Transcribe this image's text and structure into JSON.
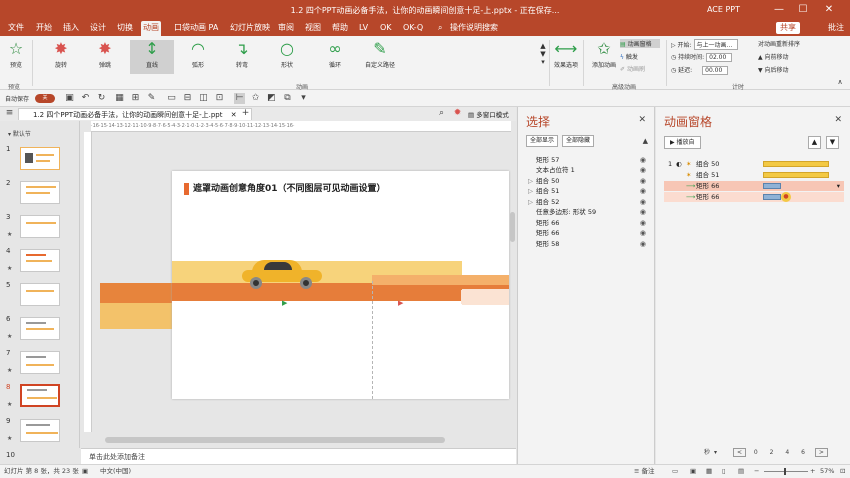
{
  "window": {
    "title": "1.2 四个PPT动画必备手法，让你的动画瞬间创意十足-上.pptx - 正在保存... ",
    "account": "ACE PPT"
  },
  "menu": {
    "tabs": [
      "文件",
      "开始",
      "插入",
      "设计",
      "切换",
      "动画",
      "口袋动画 PA",
      "幻灯片放映",
      "审阅",
      "视图",
      "帮助",
      "LV",
      "OK",
      "OK-Q"
    ],
    "active": "动画",
    "search": "操作说明搜索",
    "share": "共享",
    "comment": "批注"
  },
  "ribbon": {
    "preview": "预览",
    "preview_group": "预览",
    "animations": [
      "旋转",
      "弹跳",
      "直线",
      "弧形",
      "转弯",
      "形状",
      "循环",
      "自定义路径"
    ],
    "animations_group": "动画",
    "effect_options": "效果选项",
    "add_animation": "添加动画",
    "anim_pane": "动画窗格",
    "trigger": "触发",
    "anim_painter": "动画刷",
    "advanced_group": "高级动画",
    "start_label": "开始:",
    "start_value": "与上一动画...",
    "duration_label": "持续时间:",
    "duration_value": "02.00",
    "delay_label": "延迟:",
    "delay_value": "00.00",
    "reorder": "对动画重新排序",
    "move_earlier": "向前移动",
    "move_later": "向后移动",
    "timing_group": "计时"
  },
  "qat": {
    "autosave": "自动保存",
    "autosave_state": "关"
  },
  "doc_tab": {
    "name": "1.2 四个PPT动画必备手法，让你的动画瞬间创意十足-上.ppt",
    "multi_window": "多窗口模式"
  },
  "thumbs": {
    "section": "默认节",
    "numbers": [
      "1",
      "2",
      "3",
      "4",
      "5",
      "6",
      "7",
      "8",
      "9",
      "10"
    ],
    "selected": "8"
  },
  "slide": {
    "title": "遮罩动画创意角度01（不同图层可见动画设置）"
  },
  "notes": "单击此处添加备注",
  "selection_pane": {
    "title": "选择",
    "show_all": "全部显示",
    "hide_all": "全部隐藏",
    "items": [
      {
        "name": "矩形 57",
        "group": false
      },
      {
        "name": "文本占位符 1",
        "group": false
      },
      {
        "name": "组合 50",
        "group": true
      },
      {
        "name": "组合 51",
        "group": true
      },
      {
        "name": "组合 52",
        "group": true
      },
      {
        "name": "任意多边形: 形状 59",
        "group": false
      },
      {
        "name": "矩形 66",
        "group": false
      },
      {
        "name": "矩形 66",
        "group": false
      },
      {
        "name": "矩形 58",
        "group": false
      }
    ]
  },
  "anim_pane": {
    "title": "动画窗格",
    "play_from": "播放自",
    "rows": [
      {
        "num": "1",
        "name": "组合 50"
      },
      {
        "num": "",
        "name": "组合 51"
      },
      {
        "num": "",
        "name": "矩形 66"
      },
      {
        "num": "",
        "name": "矩形 66"
      }
    ],
    "time_unit": "秒",
    "scale": [
      "0",
      "2",
      "4",
      "6"
    ]
  },
  "status": {
    "slide_info": "幻灯片 第 8 张，共 23 张",
    "language": "中文(中国)",
    "notes_btn": "备注",
    "zoom": "57%"
  }
}
